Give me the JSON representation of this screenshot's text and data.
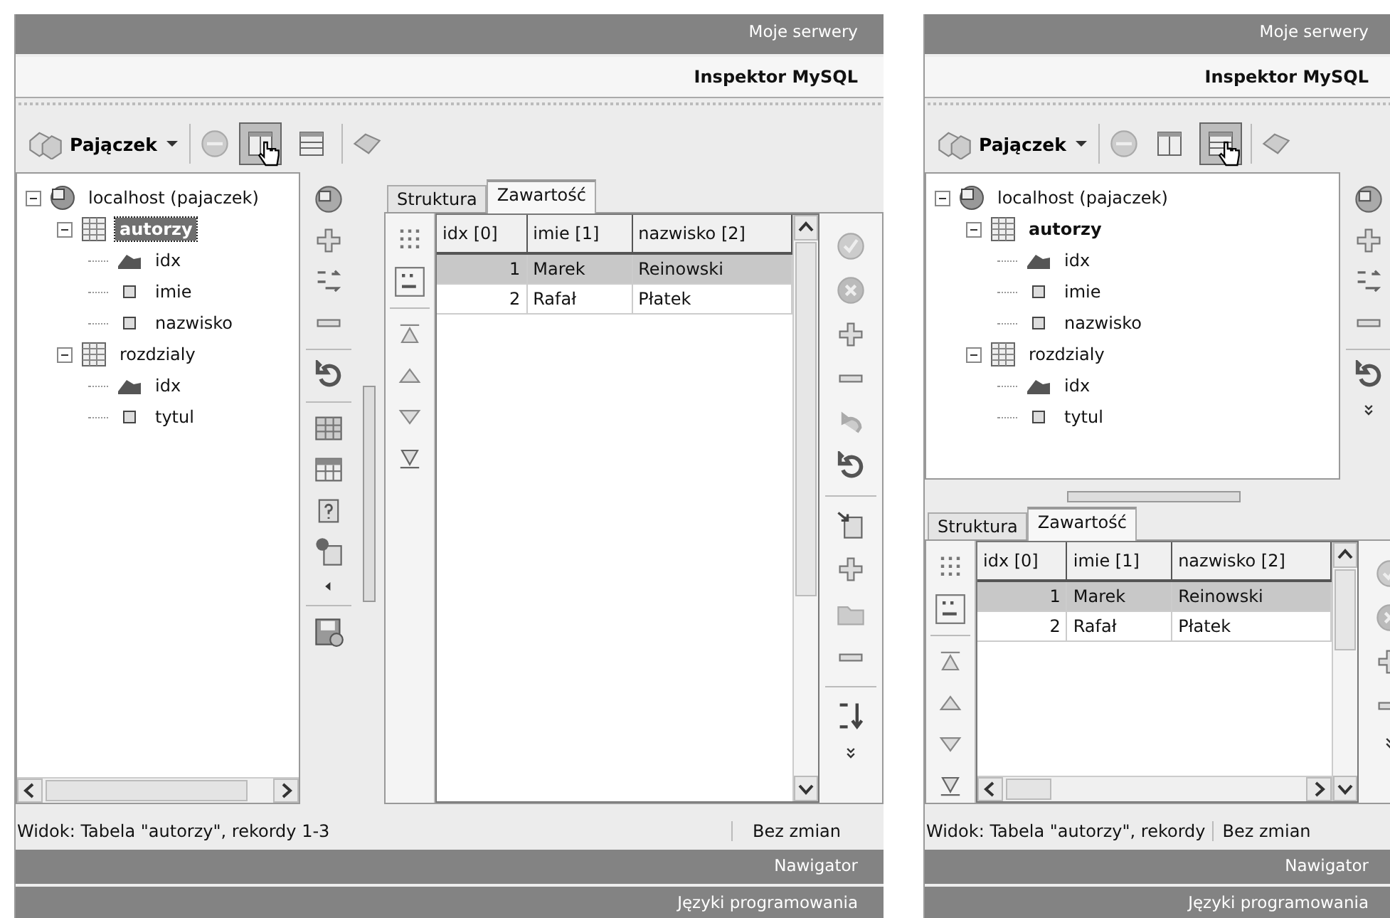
{
  "panels": [
    {
      "header": "Moje serwery",
      "title": "Inspektor MySQL",
      "toolbar": {
        "connection": "Pajączek",
        "view_buttons": [
          {
            "selected": true
          },
          {
            "selected": false
          }
        ]
      },
      "tree": [
        {
          "label": "localhost (pajaczek)",
          "kind": "server",
          "selected": false,
          "bold": false,
          "children": [
            {
              "label": "autorzy",
              "kind": "table",
              "selected": true,
              "bold": true,
              "children": [
                {
                  "label": "idx",
                  "kind": "key",
                  "selected": false,
                  "bold": false
                },
                {
                  "label": "imie",
                  "kind": "column",
                  "selected": false,
                  "bold": false
                },
                {
                  "label": "nazwisko",
                  "kind": "column",
                  "selected": false,
                  "bold": false
                }
              ]
            },
            {
              "label": "rozdzialy",
              "kind": "table",
              "selected": false,
              "bold": false,
              "children": [
                {
                  "label": "idx",
                  "kind": "key",
                  "selected": false,
                  "bold": false
                },
                {
                  "label": "tytul",
                  "kind": "column",
                  "selected": false,
                  "bold": false
                }
              ]
            }
          ]
        }
      ],
      "tabs": [
        {
          "label": "Struktura",
          "selected": false
        },
        {
          "label": "Zawartość",
          "selected": true
        }
      ],
      "table": {
        "columns": [
          "idx [0]",
          "imie [1]",
          "nazwisko [2]"
        ],
        "rows": [
          {
            "cells": [
              "1",
              "Marek",
              "Reinowski"
            ],
            "selected": true
          },
          {
            "cells": [
              "2",
              "Rafał",
              "Płatek"
            ],
            "selected": false
          }
        ]
      },
      "status": {
        "view": "Widok: Tabela \"autorzy\", rekordy 1-3",
        "changes": "Bez zmian"
      },
      "sections": [
        "Nawigator",
        "Języki programowania"
      ]
    },
    {
      "header": "Moje serwery",
      "title": "Inspektor MySQL",
      "toolbar": {
        "connection": "Pajączek",
        "view_buttons": [
          {
            "selected": false
          },
          {
            "selected": true
          }
        ]
      },
      "tree": [
        {
          "label": "localhost (pajaczek)",
          "kind": "server",
          "selected": false,
          "bold": false,
          "children": [
            {
              "label": "autorzy",
              "kind": "table",
              "selected": false,
              "bold": true,
              "children": [
                {
                  "label": "idx",
                  "kind": "key",
                  "selected": false,
                  "bold": false
                },
                {
                  "label": "imie",
                  "kind": "column",
                  "selected": false,
                  "bold": false
                },
                {
                  "label": "nazwisko",
                  "kind": "column",
                  "selected": false,
                  "bold": false
                }
              ]
            },
            {
              "label": "rozdzialy",
              "kind": "table",
              "selected": false,
              "bold": false,
              "children": [
                {
                  "label": "idx",
                  "kind": "key",
                  "selected": false,
                  "bold": false
                },
                {
                  "label": "tytul",
                  "kind": "column",
                  "selected": false,
                  "bold": false
                }
              ]
            }
          ]
        }
      ],
      "tabs": [
        {
          "label": "Struktura",
          "selected": false
        },
        {
          "label": "Zawartość",
          "selected": true
        }
      ],
      "table": {
        "columns": [
          "idx [0]",
          "imie [1]",
          "nazwisko [2]"
        ],
        "rows": [
          {
            "cells": [
              "1",
              "Marek",
              "Reinowski"
            ],
            "selected": true
          },
          {
            "cells": [
              "2",
              "Rafał",
              "Płatek"
            ],
            "selected": false
          }
        ]
      },
      "status": {
        "view": "Widok: Tabela \"autorzy\", rekordy",
        "changes": "Bez zmian"
      },
      "sections": [
        "Nawigator",
        "Języki programowania"
      ]
    }
  ]
}
